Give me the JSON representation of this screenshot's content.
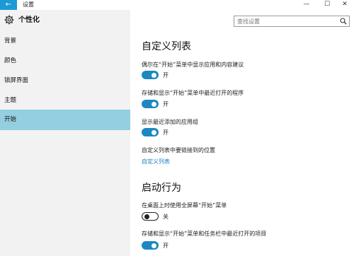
{
  "window": {
    "back_glyph": "←",
    "title": "设置",
    "min_glyph": "—",
    "max_glyph": "☐",
    "close_glyph": "✕"
  },
  "header": {
    "section_title": "个性化",
    "search_placeholder": "查找设置"
  },
  "sidebar": {
    "items": [
      {
        "label": "背景"
      },
      {
        "label": "颜色"
      },
      {
        "label": "锁屏界面"
      },
      {
        "label": "主题"
      },
      {
        "label": "开始"
      }
    ],
    "selected": "开始"
  },
  "main": {
    "custom_list": {
      "heading": "自定义列表",
      "options": [
        {
          "label": "偶尔在“开始”菜单中显示应用和内容建议",
          "state": "开",
          "on": true
        },
        {
          "label": "存储和显示“开始”菜单中最近打开的程序",
          "state": "开",
          "on": true
        },
        {
          "label": "显示最近添加的应用组",
          "state": "开",
          "on": true
        }
      ],
      "links_label": "自定义列表中要链接到的位置",
      "link": "自定义列表"
    },
    "startup": {
      "heading": "启动行为",
      "options": [
        {
          "label": "在桌面上时使用全屏幕“开始”菜单",
          "state": "关",
          "on": false
        },
        {
          "label": "存储和显示“开始”菜单和任务栏中最近打开的项目",
          "state": "开",
          "on": true
        }
      ]
    }
  },
  "colors": {
    "accent": "#1c87c2",
    "selected_nav": "#93cfe0",
    "sidebar_bg": "#f2f2f2",
    "back_button": "#1c9ad6"
  }
}
